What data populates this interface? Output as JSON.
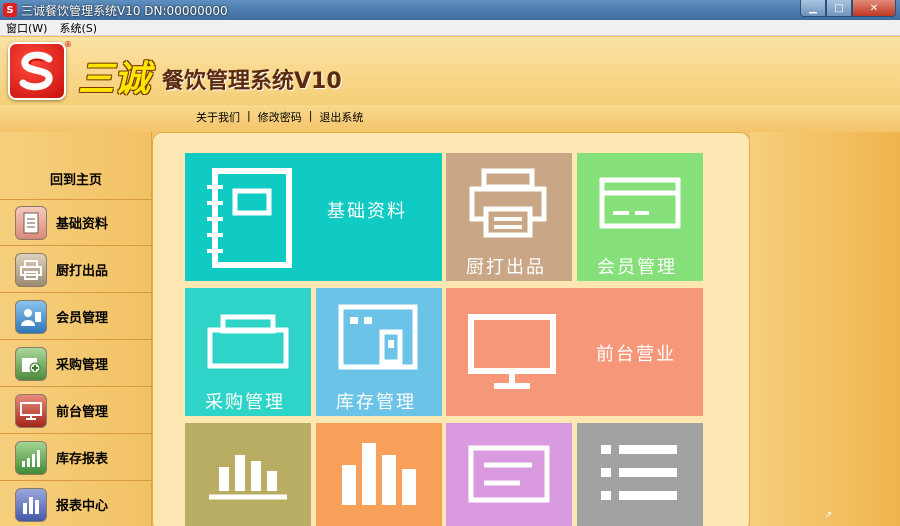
{
  "window": {
    "icon_text": "S",
    "title": "三诚餐饮管理系统V10 DN:00000000",
    "min_icon": "minimize-icon",
    "max_icon": "maximize-icon",
    "close_icon": "close-icon"
  },
  "menubar": {
    "items": [
      {
        "label": "窗口(W)"
      },
      {
        "label": "系统(S)"
      }
    ]
  },
  "header": {
    "brand": "三诚",
    "registered": "®",
    "system_name": "餐饮管理系统V10",
    "links": [
      {
        "label": "关于我们"
      },
      {
        "label": "修改密码"
      },
      {
        "label": "退出系统"
      }
    ],
    "separator": "|"
  },
  "sidebar": {
    "home": "回到主页",
    "items": [
      {
        "label": "基础资料",
        "icon": "document-icon",
        "color": "#e8a79a"
      },
      {
        "label": "厨打出品",
        "icon": "printer-icon",
        "color": "#b7a48c"
      },
      {
        "label": "会员管理",
        "icon": "member-icon",
        "color": "#3b8ed1"
      },
      {
        "label": "采购管理",
        "icon": "purchase-icon",
        "color": "#5da04a"
      },
      {
        "label": "前台管理",
        "icon": "monitor-icon",
        "color": "#c0392b"
      },
      {
        "label": "库存报表",
        "icon": "bar-chart-icon",
        "color": "#4a9a4a"
      },
      {
        "label": "报表中心",
        "icon": "report-icon",
        "color": "#5b6fb8"
      }
    ]
  },
  "tiles": [
    {
      "label": "基础资料",
      "icon": "notebook-icon",
      "color": "#0fcbc4"
    },
    {
      "label": "厨打出品",
      "icon": "printer-icon",
      "color": "#c9a786"
    },
    {
      "label": "会员管理",
      "icon": "card-icon",
      "color": "#86e07a"
    },
    {
      "label": "采购管理",
      "icon": "printer-tray-icon",
      "color": "#2fd4c8"
    },
    {
      "label": "库存管理",
      "icon": "warehouse-icon",
      "color": "#6cc3e8"
    },
    {
      "label": "前台营业",
      "icon": "monitor-icon",
      "color": "#f7977a"
    },
    {
      "label": "",
      "icon": "bar-chart-icon",
      "color": "#b8ad62"
    },
    {
      "label": "",
      "icon": "column-chart-icon",
      "color": "#f7a05a"
    },
    {
      "label": "",
      "icon": "form-icon",
      "color": "#d99adf"
    },
    {
      "label": "",
      "icon": "list-icon",
      "color": "#a2a2a2"
    }
  ]
}
